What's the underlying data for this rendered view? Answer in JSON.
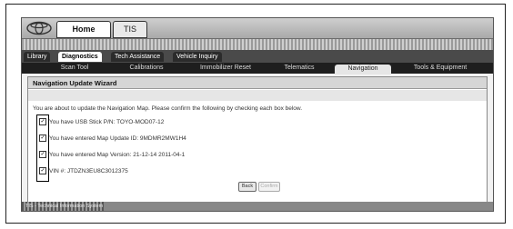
{
  "header": {
    "home_label": "Home",
    "tis_label": "TIS"
  },
  "main_tabs": [
    {
      "label": "Library"
    },
    {
      "label": "Diagnostics"
    },
    {
      "label": "Tech Assistance"
    },
    {
      "label": "Vehicle Inquiry"
    }
  ],
  "sub_tabs": [
    {
      "label": "Scan Tool"
    },
    {
      "label": "Calibrations"
    },
    {
      "label": "Immobilizer Reset"
    },
    {
      "label": "Telematics"
    },
    {
      "label": "Navigation"
    },
    {
      "label": "Tools & Equipment"
    }
  ],
  "wizard": {
    "title": "Navigation Update Wizard",
    "intro": "You are about to update the Navigation Map. Please confirm the following by checking each box below.",
    "items": [
      {
        "label": "You have USB Stick P/N: TOYO-MOD07-12",
        "checked": true
      },
      {
        "label": "You have entered Map Update ID: 9MDMR2MW1H4",
        "checked": true
      },
      {
        "label": "You have entered Map Version: 21-12-14 2011-04-1",
        "checked": true
      },
      {
        "label": "VIN #: JTDZN3EU8C3012375",
        "checked": true
      }
    ],
    "back_label": "Back",
    "next_label": "Confirm"
  },
  "status": {
    "text": "TIS - Technical Information System"
  }
}
